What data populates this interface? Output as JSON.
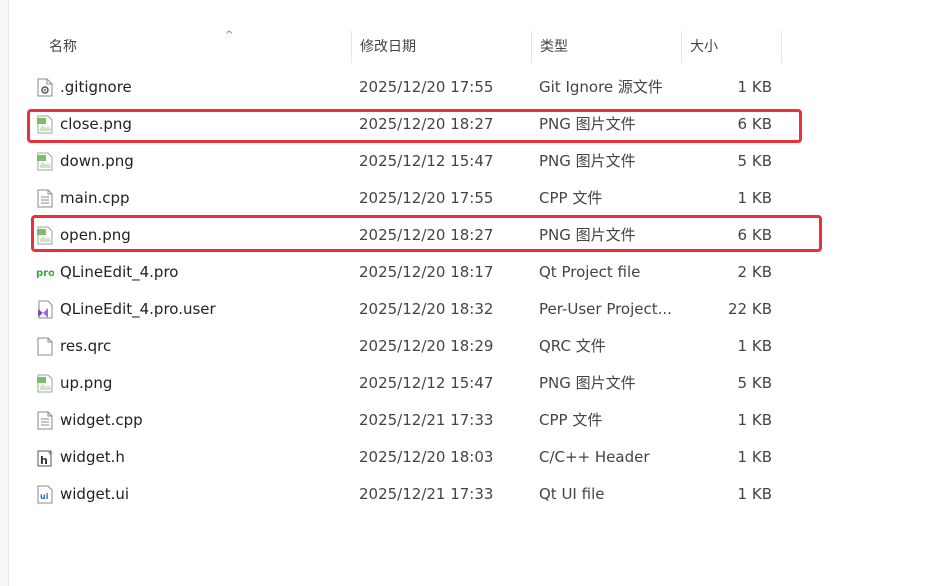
{
  "header": {
    "name": "名称",
    "date": "修改日期",
    "type": "类型",
    "size": "大小",
    "sort_caret": "^"
  },
  "files": [
    {
      "name": ".gitignore",
      "date": "2025/12/20 17:55",
      "type": "Git Ignore 源文件",
      "size": "1 KB",
      "icon": "gear-file-icon"
    },
    {
      "name": "close.png",
      "date": "2025/12/20 18:27",
      "type": "PNG 图片文件",
      "size": "6 KB",
      "icon": "image-file-icon"
    },
    {
      "name": "down.png",
      "date": "2025/12/12 15:47",
      "type": "PNG 图片文件",
      "size": "5 KB",
      "icon": "image-file-icon"
    },
    {
      "name": "main.cpp",
      "date": "2025/12/20 17:55",
      "type": "CPP 文件",
      "size": "1 KB",
      "icon": "text-file-icon"
    },
    {
      "name": "open.png",
      "date": "2025/12/20 18:27",
      "type": "PNG 图片文件",
      "size": "6 KB",
      "icon": "image-file-icon"
    },
    {
      "name": "QLineEdit_4.pro",
      "date": "2025/12/20 18:17",
      "type": "Qt Project file",
      "size": "2 KB",
      "icon": "pro-file-icon"
    },
    {
      "name": "QLineEdit_4.pro.user",
      "date": "2025/12/20 18:32",
      "type": "Per-User Project...",
      "size": "22 KB",
      "icon": "visual-studio-file-icon"
    },
    {
      "name": "res.qrc",
      "date": "2025/12/20 18:29",
      "type": "QRC 文件",
      "size": "1 KB",
      "icon": "blank-file-icon"
    },
    {
      "name": "up.png",
      "date": "2025/12/12 15:47",
      "type": "PNG 图片文件",
      "size": "5 KB",
      "icon": "image-file-icon"
    },
    {
      "name": "widget.cpp",
      "date": "2025/12/21 17:33",
      "type": "CPP 文件",
      "size": "1 KB",
      "icon": "text-file-icon"
    },
    {
      "name": "widget.h",
      "date": "2025/12/20 18:03",
      "type": "C/C++ Header",
      "size": "1 KB",
      "icon": "header-file-icon"
    },
    {
      "name": "widget.ui",
      "date": "2025/12/21 17:33",
      "type": "Qt UI file",
      "size": "1 KB",
      "icon": "ui-file-icon"
    }
  ],
  "highlight_color": "#e8313a"
}
